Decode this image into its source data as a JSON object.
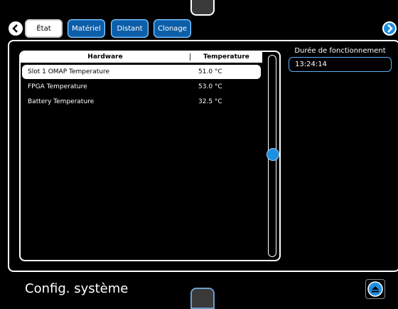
{
  "tabs": [
    {
      "label": "État"
    },
    {
      "label": "Matériel"
    },
    {
      "label": "Distant"
    },
    {
      "label": "Clonage"
    }
  ],
  "table": {
    "headers": {
      "hardware": "Hardware",
      "temperature": "Temperature"
    },
    "rows": [
      {
        "name": "Slot 1 OMAP Temperature",
        "value": "51.0 °C"
      },
      {
        "name": "FPGA Temperature",
        "value": "53.0 °C"
      },
      {
        "name": "Battery Temperature",
        "value": "32.5 °C"
      }
    ]
  },
  "uptime": {
    "label": "Durée de fonctionnement",
    "value": "13:24:14"
  },
  "footer": {
    "title": "Config. système"
  },
  "icons": {
    "left": "chevron-left-icon",
    "right": "chevron-right-icon",
    "home": "eject-up-icon"
  },
  "colors": {
    "accent": "#1f8fe0",
    "tab_blue": "#0d5ea8"
  }
}
